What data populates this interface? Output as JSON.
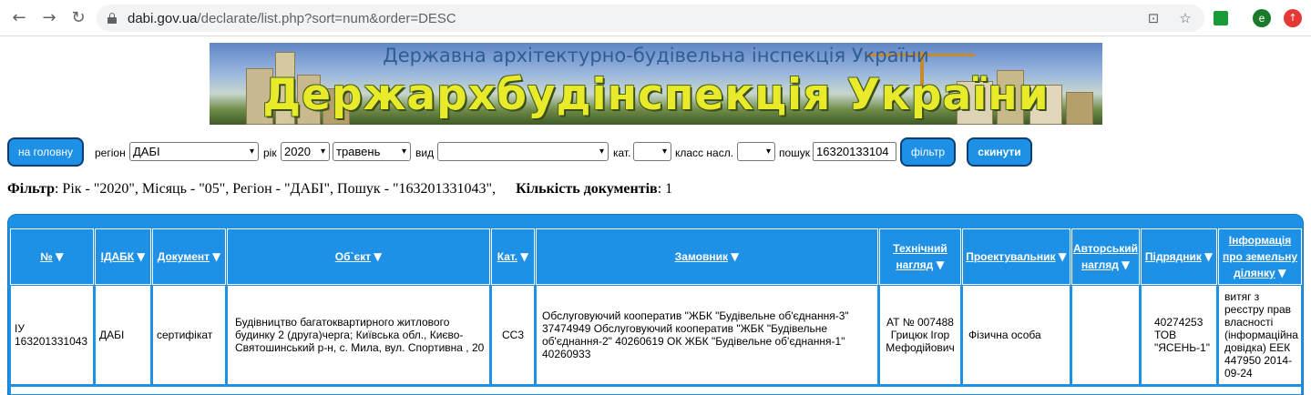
{
  "browser": {
    "url_host": "dabi.gov.ua",
    "url_path": "/declarate/list.php?sort=num&order=DESC",
    "profile_letter": "e"
  },
  "banner": {
    "subtitle": "Державна архітектурно-будівельна інспекція України",
    "title": "Держархбудінспекція України"
  },
  "filters": {
    "home_button": "на головну",
    "region_label": "регіон",
    "region_value": "ДАБІ",
    "year_label": "рік",
    "year_value": "2020",
    "month_value": "травень",
    "type_label": "вид",
    "type_value": "",
    "cat_label": "кат.",
    "cat_value": "",
    "class_label": "класс насл.",
    "class_value": "",
    "search_label": "пошук",
    "search_value": "16320133104",
    "filter_button": "фільтр",
    "reset_button": "скинути"
  },
  "summary": {
    "filter_label": "Фільтр",
    "filter_text": ": Рік - \"2020\", Місяць - \"05\", Регіон - \"ДАБІ\", Пошук - \"163201331043\",",
    "count_label": "Кількість документів",
    "count_value": ": 1"
  },
  "table": {
    "headers": {
      "num": "№",
      "idabk": "ІДАБК",
      "document": "Документ",
      "object": "Об`єкт",
      "cat": "Кат.",
      "customer": "Замовник",
      "tech_sup": "Технічний нагляд",
      "designer": "Проектувальник",
      "author_sup": "Авторський нагляд",
      "contractor": "Підрядник",
      "land_info": "Інформація про земельну ділянку"
    },
    "row": {
      "num": "ІУ 163201331043",
      "idabk": "ДАБІ",
      "document": "сертифікат",
      "object": "Будівництво багатоквартирного житлового будинку 2 (друга)черга; Київська обл., Києво-Святошинський р-н, с. Мила, вул. Спортивна , 20",
      "cat": "СС3",
      "customer": "Обслуговуючий кооператив \"ЖБК \"Будівельне об'єднання-3\" 37474949 Обслуговуючий кооператив \"ЖБК \"Будівельне об'єднання-2\" 40260619 ОК ЖБК \"Будівельне об'єднання-1\" 40260933",
      "tech_sup": "АТ № 007488 Грицюк Ігор Мефодійович",
      "designer": "Фізична особа",
      "author_sup": "",
      "contractor": "40274253 ТОВ \"ЯСЕНЬ-1\"",
      "land_info": "витяг з реєстру прав власності (інформаційна довідка) ЕЕК 447950 2014-09-24"
    },
    "sort_arrow": "▼"
  },
  "colors": {
    "accent": "#1e90e6",
    "button_border": "#0b3e73"
  }
}
